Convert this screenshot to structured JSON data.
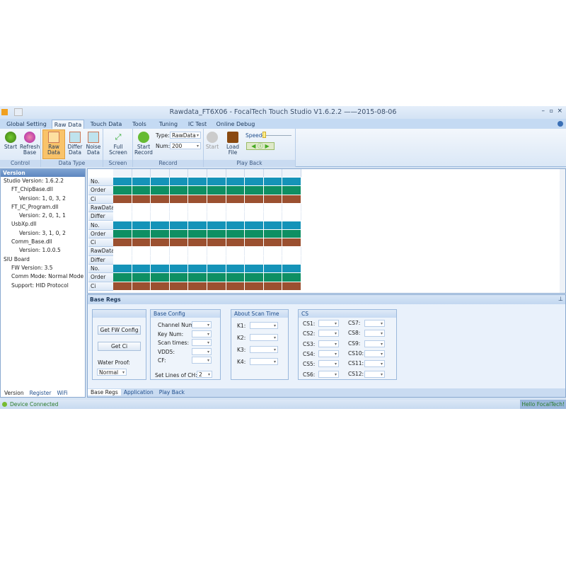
{
  "window": {
    "title": "Rawdata_FT6X06 - FocalTech Touch Studio    V1.6.2.2     ——2015-08-06"
  },
  "colors": {
    "no": "#1593b8",
    "order": "#0e8f63",
    "ci": "#9b5030"
  },
  "menu_tabs": [
    "Global Setting",
    "Raw Data",
    "Touch Data",
    "Tools",
    "Tuning",
    "IC Test",
    "Online Debug"
  ],
  "ribbon": {
    "control": {
      "label": "Control",
      "start": "Start",
      "refresh": "Refresh Base"
    },
    "datatype": {
      "label": "Data Type",
      "raw": "Raw Data",
      "differ": "Differ Data",
      "noise": "Noise Data"
    },
    "screen": {
      "label": "Screen",
      "full": "Full Screen"
    },
    "record": {
      "label": "Record",
      "start": "Start Record",
      "type_label": "Type:",
      "type_value": "RawData",
      "num_label": "Num:",
      "num_value": "200"
    },
    "playback": {
      "label": "Play Back",
      "start": "Start",
      "load": "Load File",
      "speed": "Speed"
    }
  },
  "sidebar": {
    "title": "Version",
    "tree": [
      "Studio Version: 1.6.2.2",
      "FT_ChipBase.dll",
      "Version: 1, 0, 3, 2",
      "FT_IC_Program.dll",
      "Version: 2, 0, 1, 1",
      "UsbXp.dll",
      "Version: 3, 1, 0, 2",
      "Comm_Base.dll",
      "Version: 1.0.0.5",
      "SIU Board",
      "FW Version: 3.5",
      "Comm Mode: Normal Mode",
      "Support: HID Protocol"
    ],
    "tabs": [
      "Version",
      "Register",
      "WiFi"
    ]
  },
  "grid": {
    "rows": [
      "No.",
      "Order",
      "Ci",
      "RawData",
      "Differ",
      "No.",
      "Order",
      "Ci",
      "RawData",
      "Differ",
      "No.",
      "Order",
      "Ci"
    ]
  },
  "base_regs": {
    "title": "Base Regs",
    "buttons": {
      "fw": "Get FW Config",
      "ci": "Get Ci"
    },
    "water_proof": "Water Proof:",
    "water_value": "Normal",
    "base_config": {
      "title": "Base Config",
      "fields": [
        "Channel Num:",
        "Key Num:",
        "Scan times:",
        "VDD5:",
        "CF:"
      ],
      "lines_label": "Set Lines of CH:",
      "lines_value": "2"
    },
    "scan": {
      "title": "About Scan Time",
      "fields": [
        "K1:",
        "K2:",
        "K3:",
        "K4:"
      ]
    },
    "cs": {
      "title": "CS",
      "left": [
        "CS1:",
        "CS2:",
        "CS3:",
        "CS4:",
        "CS5:",
        "CS6:"
      ],
      "right": [
        "CS7:",
        "CS8:",
        "CS9:",
        "CS10:",
        "CS11:",
        "CS12:"
      ]
    },
    "tabs": [
      "Base Regs",
      "Application",
      "Play Back"
    ]
  },
  "status": {
    "left": "Device Connected",
    "right": "Hello FocalTech!"
  }
}
